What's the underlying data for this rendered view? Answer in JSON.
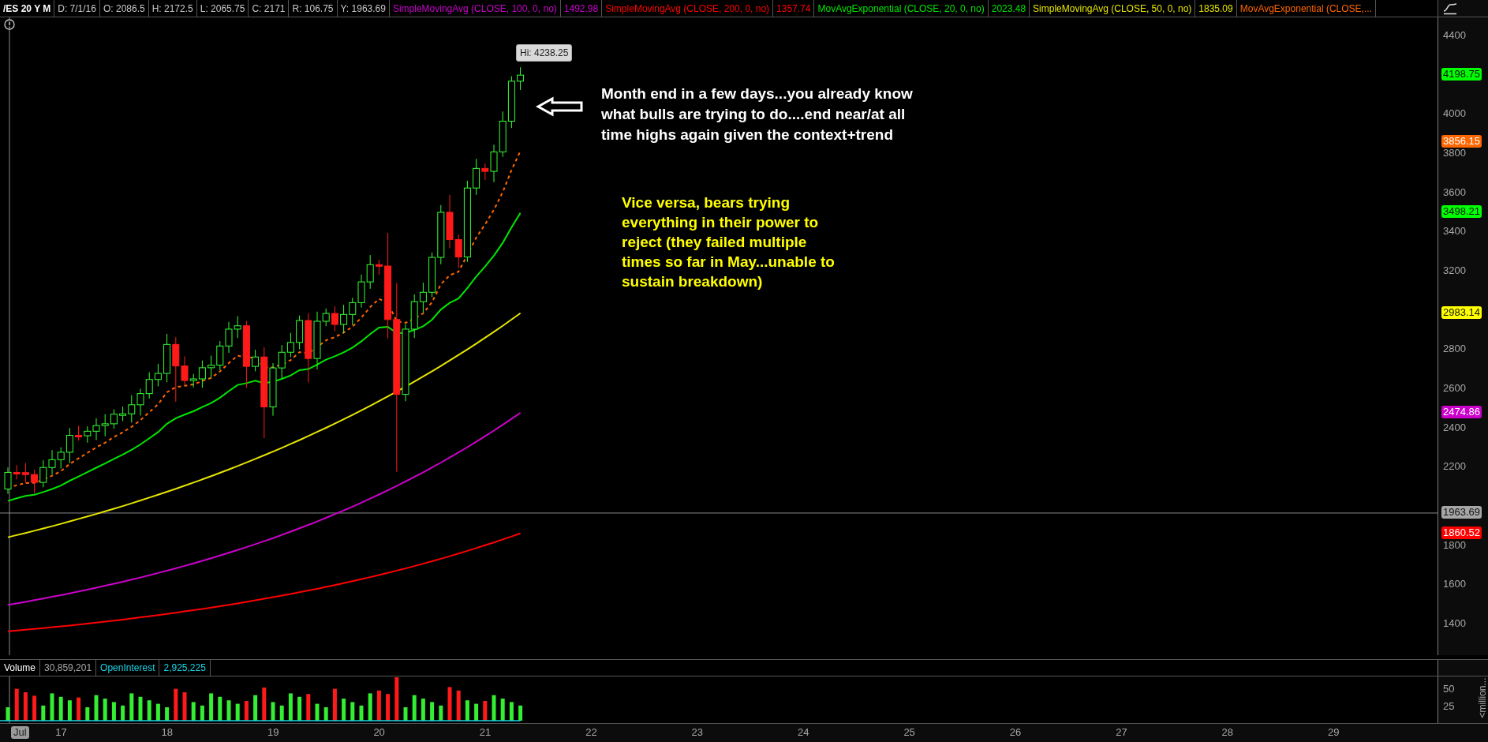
{
  "header": {
    "symbol": "/ES 20 Y M",
    "fields": [
      "D: 7/1/16",
      "O: 2086.5",
      "H: 2172.5",
      "L: 2065.75",
      "C: 2171",
      "R: 106.75",
      "Y: 1963.69"
    ],
    "studies": [
      {
        "name": "SimpleMovingAvg (CLOSE, 100, 0, no)",
        "value": "1492.98",
        "color": "#cc00cc"
      },
      {
        "name": "SimpleMovingAvg (CLOSE, 200, 0, no)",
        "value": "1357.74",
        "color": "#ff0000"
      },
      {
        "name": "MovAvgExponential (CLOSE, 20, 0, no)",
        "value": "2023.48",
        "color": "#00e600"
      },
      {
        "name": "SimpleMovingAvg (CLOSE, 50, 0, no)",
        "value": "1835.09",
        "color": "#e6e600"
      },
      {
        "name": "MovAvgExponential (CLOSE,...",
        "color": "#ff6600"
      }
    ]
  },
  "price_axis": {
    "ticks": [
      "4400",
      "4000",
      "3800",
      "3600",
      "3400",
      "3200",
      "2800",
      "2600",
      "2400",
      "2200",
      "1800",
      "1600",
      "1400"
    ],
    "labels": [
      {
        "label": "4198.75",
        "color": "#00ff00"
      },
      {
        "label": "3856.15",
        "color": "#ff6600"
      },
      {
        "label": "3498.21",
        "color": "#00ff00"
      },
      {
        "label": "2983.14",
        "color": "#ffff00"
      },
      {
        "label": "2474.86",
        "color": "#cc00cc"
      },
      {
        "label": "1963.69",
        "color": "#a6a6a6"
      },
      {
        "label": "1860.52",
        "color": "#ff0000"
      }
    ]
  },
  "annotations": {
    "high_bubble": "Hi: 4238.25",
    "note": "Month end in a few days...you already know what bulls are trying to do....end near/at all time highs again given the context+trend",
    "note_2": "Vice versa, bears trying everything in their power to reject (they failed multiple times so far in May...unable to sustain breakdown)"
  },
  "volume": {
    "label": "Volume",
    "value": "30,859,201",
    "oi_label": "OpenInterest",
    "oi_value": "2,925,225",
    "ticks": [
      "50",
      "25"
    ],
    "unit": "<million..."
  },
  "time_axis": {
    "month_badge": "Jul",
    "years": [
      "17",
      "18",
      "19",
      "20",
      "21",
      "22",
      "23",
      "24",
      "25",
      "26",
      "27",
      "28",
      "29"
    ]
  }
}
